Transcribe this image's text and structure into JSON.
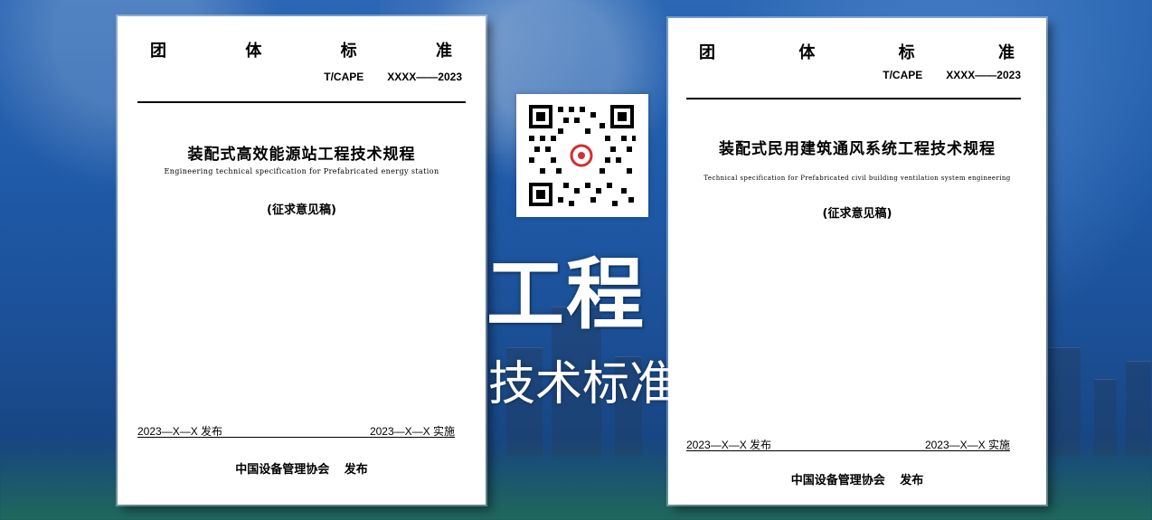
{
  "banner": {
    "word_large": "工程",
    "word_medium": "技术标准"
  },
  "qr": {
    "icon": "qr-code-icon",
    "logo_icon": "association-logo-icon",
    "logo_color": "#d32f2f"
  },
  "documents": [
    {
      "header": [
        "团",
        "体",
        "标",
        "准"
      ],
      "code_prefix": "T/CAPE",
      "code_number": "XXXX——2023",
      "title": "装配式高效能源站工程技术规程",
      "subtitle": "Engineering  technical specification for  Prefabricated energy station",
      "draft_label": "(征求意见稿)",
      "publish_date": "2023—X—X   发布",
      "implement_date": "2023—X—X   实施",
      "publisher": "中国设备管理协会",
      "publish_word": "发布"
    },
    {
      "header": [
        "团",
        "体",
        "标",
        "准"
      ],
      "code_prefix": "T/CAPE",
      "code_number": "XXXX——2023",
      "title": "装配式民用建筑通风系统工程技术规程",
      "subtitle": "Technical specification for Prefabricated civil building ventilation system engineering",
      "draft_label": "(征求意见稿)",
      "publish_date": "2023—X—X   发布",
      "implement_date": "2023—X—X   实施",
      "publisher": "中国设备管理协会",
      "publish_word": "发布"
    }
  ]
}
